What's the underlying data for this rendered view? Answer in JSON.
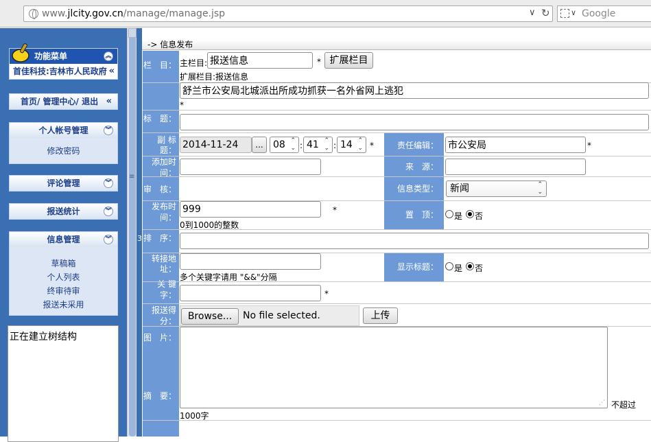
{
  "browser": {
    "url_prefix": "www.",
    "url_domain": "jlcity.gov.cn",
    "url_path": "/manage/manage.jsp",
    "search_placeholder": "Google",
    "dropdown_glyph": "∨",
    "reload_glyph": "↻"
  },
  "sidebar": {
    "menu_title": "功能菜单",
    "org_line": "首佳科技:吉林市人民政府",
    "nav_links": "首页/ 管理中心/ 退出",
    "collapse_glyph": "«",
    "expand_glyph": "»",
    "panels": [
      {
        "title": "个人帐号管理",
        "items": [
          "修改密码"
        ]
      },
      {
        "title": "评论管理",
        "items": []
      },
      {
        "title": "报送统计",
        "items": []
      },
      {
        "title": "信息管理",
        "items": [
          "草稿箱",
          "个人列表",
          "终审待审",
          "报送未采用"
        ]
      }
    ],
    "tree_status": "正在建立树结构",
    "grip": "≡",
    "stray_number": "3"
  },
  "form": {
    "breadcrumb": "-> 信息发布",
    "required_mark": "*",
    "column": {
      "label": "栏　目：",
      "main_prefix": "主栏目:",
      "main_value": "报送信息",
      "extend_button": "扩展栏目",
      "extend_text": "扩展栏目:报送信息"
    },
    "title": {
      "label": "标　题：",
      "value": "舒兰市公安局北城派出所成功抓获一名外省网上逃犯"
    },
    "subtitle": {
      "label1": "副 标",
      "label2": "题：",
      "value": ""
    },
    "add_time": {
      "label1": "添加时",
      "label2": "间：",
      "date": "2014-11-24",
      "dots": "...",
      "hour": "08",
      "minute": "41",
      "second": "14",
      "colon": ":",
      "spin_glyph": "⌃⌄"
    },
    "editor": {
      "label": "责任编辑：",
      "value": "市公安局"
    },
    "review": {
      "label": "审　核：",
      "value": ""
    },
    "source": {
      "label": "来　源：",
      "value": ""
    },
    "publish_time": {
      "label1": "发布时",
      "label2": "间："
    },
    "info_type": {
      "label": "信息类型：",
      "selected": "新闻"
    },
    "sort": {
      "label": "排　序：",
      "value": "999",
      "hint": "0到1000的整数"
    },
    "pin": {
      "label": "置　顶：",
      "yes": "是",
      "no": "否",
      "selected": "no"
    },
    "redirect": {
      "label1": "转接地",
      "label2": "址：",
      "value": ""
    },
    "keywords": {
      "label1": "关 键",
      "label2": "字：",
      "value": "",
      "hint": "多个关键字请用 \"&&\"分隔"
    },
    "show_title": {
      "label": "显示标题：",
      "yes": "是",
      "no": "否",
      "selected": "no"
    },
    "report_score": {
      "label1": "报送得",
      "label2": "分：",
      "value": ""
    },
    "image": {
      "label": "图　片：",
      "browse": "Browse...",
      "no_file": "No file selected.",
      "upload": "上传"
    },
    "summary": {
      "label": "摘　要：",
      "limit1": "不超过",
      "limit2": "1000字",
      "grip": "⋰"
    }
  },
  "colors": {
    "sidebar_bg": "#3b6fb3",
    "label_bg": "#6d9ad6",
    "panel_text": "#1d3f8a",
    "panel_body": "#dde6f4"
  }
}
